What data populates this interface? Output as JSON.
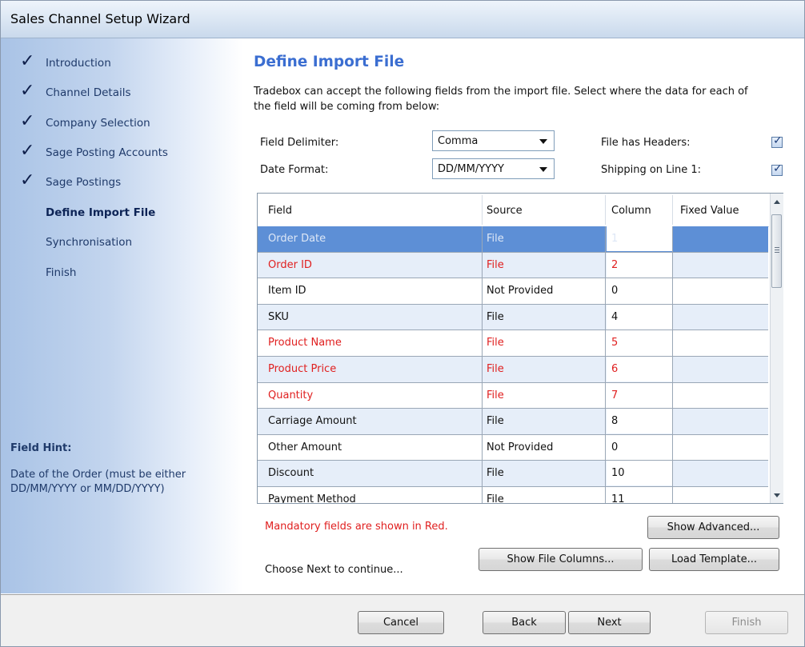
{
  "window": {
    "title": "Sales Channel Setup Wizard"
  },
  "sidebar": {
    "steps": [
      {
        "label": "Introduction",
        "done": true
      },
      {
        "label": "Channel Details",
        "done": true
      },
      {
        "label": "Company Selection",
        "done": true
      },
      {
        "label": "Sage Posting Accounts",
        "done": true
      },
      {
        "label": "Sage Postings",
        "done": true
      },
      {
        "label": "Define Import File",
        "done": false,
        "current": true
      },
      {
        "label": "Synchronisation",
        "done": false
      },
      {
        "label": "Finish",
        "done": false
      }
    ],
    "check_glyph": "✓",
    "hint_title": "Field Hint:",
    "hint_text": "Date of the Order (must be either DD/MM/YYYY or MM/DD/YYYY)"
  },
  "main": {
    "title": "Define Import File",
    "intro": "Tradebox can accept the following fields from the import file.  Select where the data for each of the field will be coming from below:",
    "field_delimiter_label": "Field Delimiter:",
    "field_delimiter_value": "Comma",
    "date_format_label": "Date Format:",
    "date_format_value": "DD/MM/YYYY",
    "file_has_headers_label": "File has Headers:",
    "file_has_headers_checked": true,
    "shipping_on_line_label": "Shipping on Line 1:",
    "shipping_on_line_checked": true,
    "check_glyph": "✓"
  },
  "grid": {
    "headers": [
      "Field",
      "Source",
      "Column",
      "Fixed Value"
    ],
    "rows": [
      {
        "field": "Order Date",
        "source": "File",
        "column": "1",
        "fixed": "",
        "mandatory": true,
        "selected": true
      },
      {
        "field": "Order ID",
        "source": "File",
        "column": "2",
        "fixed": "",
        "mandatory": true
      },
      {
        "field": "Item ID",
        "source": "Not Provided",
        "column": "0",
        "fixed": ""
      },
      {
        "field": "SKU",
        "source": "File",
        "column": "4",
        "fixed": ""
      },
      {
        "field": "Product Name",
        "source": "File",
        "column": "5",
        "fixed": "",
        "mandatory": true
      },
      {
        "field": "Product Price",
        "source": "File",
        "column": "6",
        "fixed": "",
        "mandatory": true
      },
      {
        "field": "Quantity",
        "source": "File",
        "column": "7",
        "fixed": "",
        "mandatory": true
      },
      {
        "field": "Carriage Amount",
        "source": "File",
        "column": "8",
        "fixed": ""
      },
      {
        "field": "Other Amount",
        "source": "Not Provided",
        "column": "0",
        "fixed": ""
      },
      {
        "field": "Discount",
        "source": "File",
        "column": "10",
        "fixed": ""
      },
      {
        "field": "Payment Method",
        "source": "File",
        "column": "11",
        "fixed": ""
      }
    ]
  },
  "notes": {
    "mandatory": "Mandatory fields are shown in Red.",
    "continue": "Choose Next to continue..."
  },
  "buttons": {
    "show_advanced": "Show Advanced...",
    "show_file_columns": "Show File Columns...",
    "load_template": "Load Template...",
    "cancel": "Cancel",
    "back": "Back",
    "next": "Next",
    "finish": "Finish"
  },
  "colors": {
    "page_title": "#3b6ed1",
    "mandatory_text": "#e02020",
    "selected_row": "#5d8fd6",
    "alt_row": "#e6eef9"
  }
}
